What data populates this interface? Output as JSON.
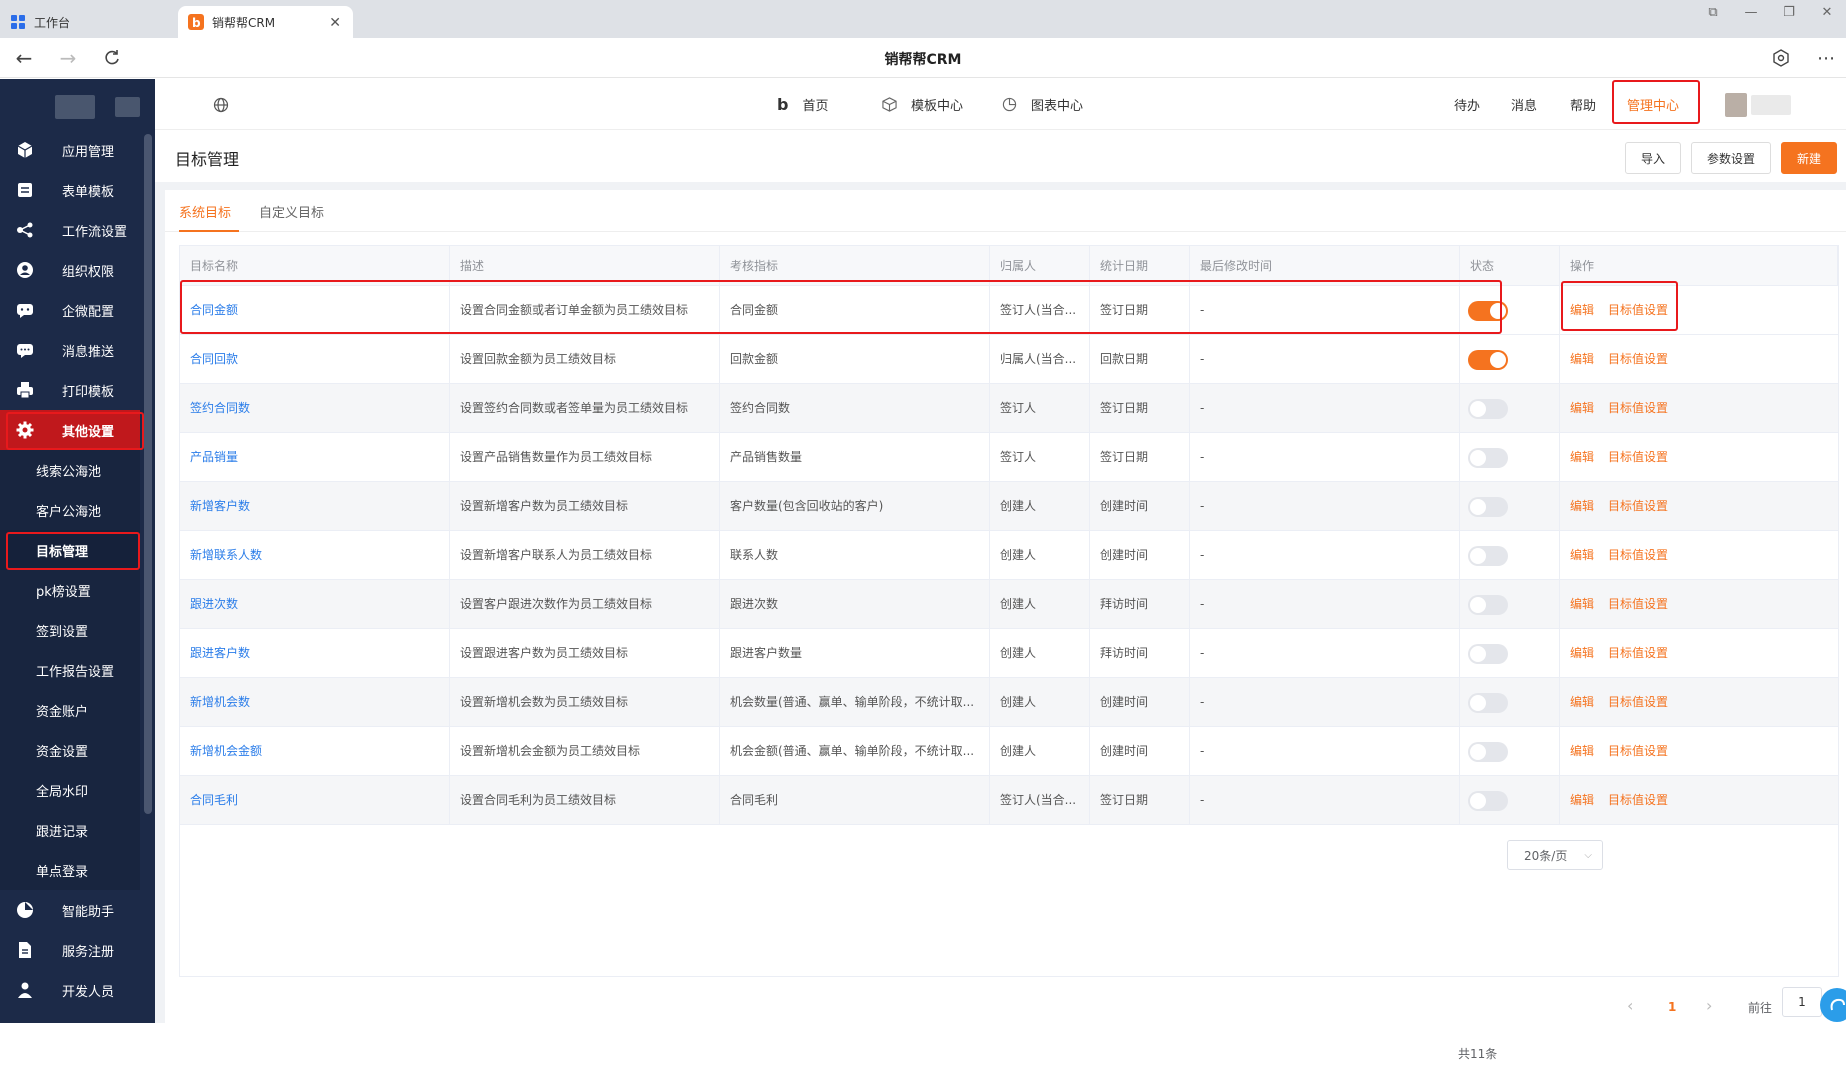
{
  "browser": {
    "home_tab": "工作台",
    "active_tab": "销帮帮CRM",
    "page_title": "销帮帮CRM"
  },
  "topnav": {
    "home": "首页",
    "templates": "模板中心",
    "charts": "图表中心",
    "todo": "待办",
    "messages": "消息",
    "help": "帮助",
    "admin": "管理中心"
  },
  "sidebar": {
    "items": [
      {
        "label": "应用管理",
        "icon": "cube-icon"
      },
      {
        "label": "表单模板",
        "icon": "form-icon"
      },
      {
        "label": "工作流设置",
        "icon": "workflow-icon"
      },
      {
        "label": "组织权限",
        "icon": "user-icon"
      },
      {
        "label": "企微配置",
        "icon": "wechat-icon"
      },
      {
        "label": "消息推送",
        "icon": "chat-icon"
      },
      {
        "label": "打印模板",
        "icon": "printer-icon"
      },
      {
        "label": "其他设置",
        "icon": "gear-icon"
      }
    ],
    "subitems": [
      "线索公海池",
      "客户公海池",
      "目标管理",
      "pk榜设置",
      "签到设置",
      "工作报告设置",
      "资金账户",
      "资金设置",
      "全局水印",
      "跟进记录",
      "单点登录"
    ],
    "bottom": [
      {
        "label": "智能助手",
        "icon": "pie-icon"
      },
      {
        "label": "服务注册",
        "icon": "doc-icon"
      },
      {
        "label": "开发人员",
        "icon": "person-icon"
      }
    ]
  },
  "page": {
    "title": "目标管理",
    "import_label": "导入",
    "params_label": "参数设置",
    "new_label": "新建",
    "tab_system": "系统目标",
    "tab_custom": "自定义目标"
  },
  "table": {
    "columns": [
      "目标名称",
      "描述",
      "考核指标",
      "归属人",
      "统计日期",
      "最后修改时间",
      "状态",
      "操作"
    ],
    "edit_label": "编辑",
    "target_label": "目标值设置",
    "rows": [
      {
        "name": "合同金额",
        "desc": "设置合同金额或者订单金额为员工绩效目标",
        "metric": "合同金额",
        "owner": "签订人(当合...",
        "date": "签订日期",
        "modified": "-",
        "on": true
      },
      {
        "name": "合同回款",
        "desc": "设置回款金额为员工绩效目标",
        "metric": "回款金额",
        "owner": "归属人(当合...",
        "date": "回款日期",
        "modified": "-",
        "on": true
      },
      {
        "name": "签约合同数",
        "desc": "设置签约合同数或者签单量为员工绩效目标",
        "metric": "签约合同数",
        "owner": "签订人",
        "date": "签订日期",
        "modified": "-",
        "on": false
      },
      {
        "name": "产品销量",
        "desc": "设置产品销售数量作为员工绩效目标",
        "metric": "产品销售数量",
        "owner": "签订人",
        "date": "签订日期",
        "modified": "-",
        "on": false
      },
      {
        "name": "新增客户数",
        "desc": "设置新增客户数为员工绩效目标",
        "metric": "客户数量(包含回收站的客户)",
        "owner": "创建人",
        "date": "创建时间",
        "modified": "-",
        "on": false
      },
      {
        "name": "新增联系人数",
        "desc": "设置新增客户联系人为员工绩效目标",
        "metric": "联系人数",
        "owner": "创建人",
        "date": "创建时间",
        "modified": "-",
        "on": false
      },
      {
        "name": "跟进次数",
        "desc": "设置客户跟进次数作为员工绩效目标",
        "metric": "跟进次数",
        "owner": "创建人",
        "date": "拜访时间",
        "modified": "-",
        "on": false
      },
      {
        "name": "跟进客户数",
        "desc": "设置跟进客户数为员工绩效目标",
        "metric": "跟进客户数量",
        "owner": "创建人",
        "date": "拜访时间",
        "modified": "-",
        "on": false
      },
      {
        "name": "新增机会数",
        "desc": "设置新增机会数为员工绩效目标",
        "metric": "机会数量(普通、赢单、输单阶段，不统计取...",
        "owner": "创建人",
        "date": "创建时间",
        "modified": "-",
        "on": false
      },
      {
        "name": "新增机会金额",
        "desc": "设置新增机会金额为员工绩效目标",
        "metric": "机会金额(普通、赢单、输单阶段，不统计取...",
        "owner": "创建人",
        "date": "创建时间",
        "modified": "-",
        "on": false
      },
      {
        "name": "合同毛利",
        "desc": "设置合同毛利为员工绩效目标",
        "metric": "合同毛利",
        "owner": "签订人(当合...",
        "date": "签订日期",
        "modified": "-",
        "on": false
      }
    ]
  },
  "pagination": {
    "total": "共11条",
    "per_page": "20条/页",
    "current": "1",
    "goto_label": "前往",
    "goto_value": "1"
  },
  "colors": {
    "accent": "#f5731f",
    "link": "#2b7de9",
    "sidebar": "#1c2a48",
    "highlight": "#e8191c"
  }
}
